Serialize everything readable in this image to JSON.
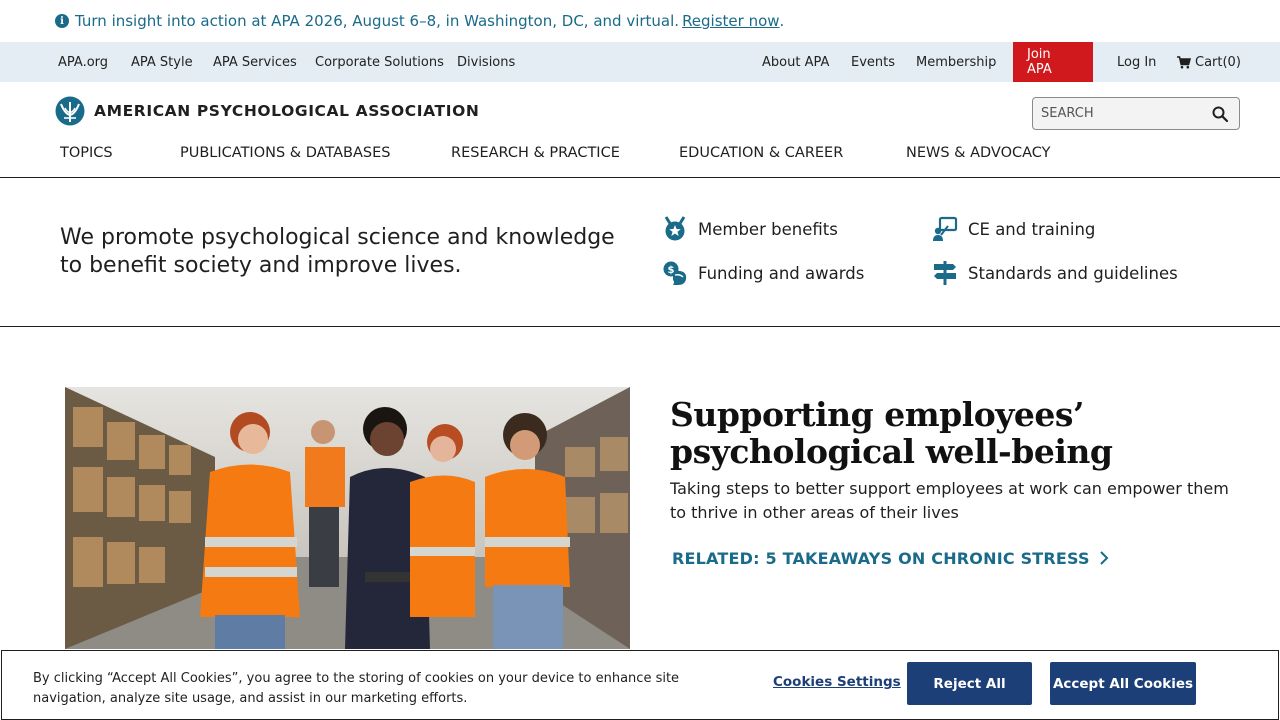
{
  "announcement": {
    "text": "Turn insight into action at APA 2026, August 6–8, in Washington, DC, and virtual.",
    "link": "Register now",
    "trailing": "."
  },
  "utility_nav": {
    "left": [
      "APA.org",
      "APA Style",
      "APA Services",
      "Corporate Solutions",
      "Divisions"
    ],
    "right": {
      "about": "About APA",
      "events": "Events",
      "membership": "Membership",
      "join": "Join APA",
      "login": "Log In",
      "cart": "Cart(0)"
    }
  },
  "header": {
    "logo_text": "AMERICAN PSYCHOLOGICAL ASSOCIATION",
    "search_placeholder": "SEARCH"
  },
  "main_nav": [
    "TOPICS",
    "PUBLICATIONS & DATABASES",
    "RESEARCH & PRACTICE",
    "EDUCATION & CAREER",
    "NEWS & ADVOCACY"
  ],
  "mission": {
    "text": "We promote psychological science and knowledge to benefit society and improve lives."
  },
  "quick_links": [
    {
      "label": "Member benefits",
      "icon": "medal-icon"
    },
    {
      "label": "CE and training",
      "icon": "presentation-icon"
    },
    {
      "label": "Funding and awards",
      "icon": "funding-icon"
    },
    {
      "label": "Standards and guidelines",
      "icon": "signpost-icon"
    }
  ],
  "hero": {
    "title": "Supporting employees’ psychological well-being",
    "description": "Taking steps to better support employees at work can empower them to thrive in other areas of their lives",
    "related": "RELATED: 5 TAKEAWAYS ON CHRONIC STRESS"
  },
  "cookie": {
    "text": "By clicking “Accept All Cookies”, you agree to the storing of cookies on your device to enhance site navigation, analyze site usage, and assist in our marketing efforts.",
    "settings": "Cookies Settings",
    "reject": "Reject All",
    "accept": "Accept All Cookies"
  },
  "colors": {
    "brand_teal": "#1a6a8a",
    "join_red": "#d0191c",
    "cookie_navy": "#1d3f77",
    "util_bg": "#e3edf3"
  }
}
